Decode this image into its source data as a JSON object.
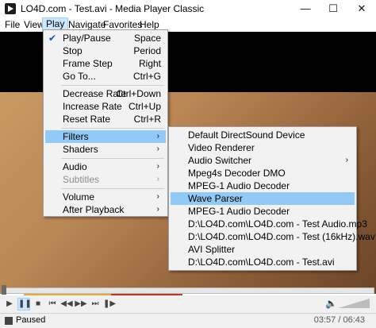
{
  "window": {
    "title": "LO4D.com - Test.avi - Media Player Classic",
    "min": "—",
    "max": "☐",
    "close": "✕"
  },
  "menubar": [
    "File",
    "View",
    "Play",
    "Navigate",
    "Favorites",
    "Help"
  ],
  "play_menu": {
    "items": [
      {
        "label": "Play/Pause",
        "shortcut": "Space",
        "checked": true
      },
      {
        "label": "Stop",
        "shortcut": "Period"
      },
      {
        "label": "Frame Step",
        "shortcut": "Right"
      },
      {
        "label": "Go To...",
        "shortcut": "Ctrl+G"
      },
      {
        "label": "Decrease Rate",
        "shortcut": "Ctrl+Down"
      },
      {
        "label": "Increase Rate",
        "shortcut": "Ctrl+Up"
      },
      {
        "label": "Reset Rate",
        "shortcut": "Ctrl+R"
      },
      {
        "label": "Filters",
        "arrow": "›"
      },
      {
        "label": "Shaders",
        "arrow": "›"
      },
      {
        "label": "Audio",
        "arrow": "›"
      },
      {
        "label": "Subtitles",
        "arrow": "›"
      },
      {
        "label": "Volume",
        "arrow": "›"
      },
      {
        "label": "After Playback",
        "arrow": "›"
      }
    ]
  },
  "filters_menu": {
    "items": [
      {
        "label": "Default DirectSound Device"
      },
      {
        "label": "Video Renderer"
      },
      {
        "label": "Audio Switcher",
        "arrow": "›"
      },
      {
        "label": "Mpeg4s Decoder DMO"
      },
      {
        "label": "MPEG-1 Audio Decoder"
      },
      {
        "label": "Wave Parser"
      },
      {
        "label": "MPEG-1 Audio Decoder"
      },
      {
        "label": "D:\\LO4D.com\\LO4D.com - Test Audio.mp3"
      },
      {
        "label": "D:\\LO4D.com\\LO4D.com - Test (16kHz).wav"
      },
      {
        "label": "AVI Splitter"
      },
      {
        "label": "D:\\LO4D.com\\LO4D.com - Test.avi"
      }
    ]
  },
  "controls": {
    "play": "▶",
    "pause": "❚❚",
    "stop": "■",
    "prev": "⏮",
    "rew": "◀◀",
    "ffwd": "▶▶",
    "next": "⏭",
    "frame": "❚▶",
    "volume_icon": "🔈"
  },
  "status": {
    "text": "Paused",
    "time": "03:57 / 06:43"
  },
  "colors": {
    "highlight": "#91c9f7",
    "menu_bg": "#f2f2f2",
    "active_menu": "#cce8ff"
  }
}
